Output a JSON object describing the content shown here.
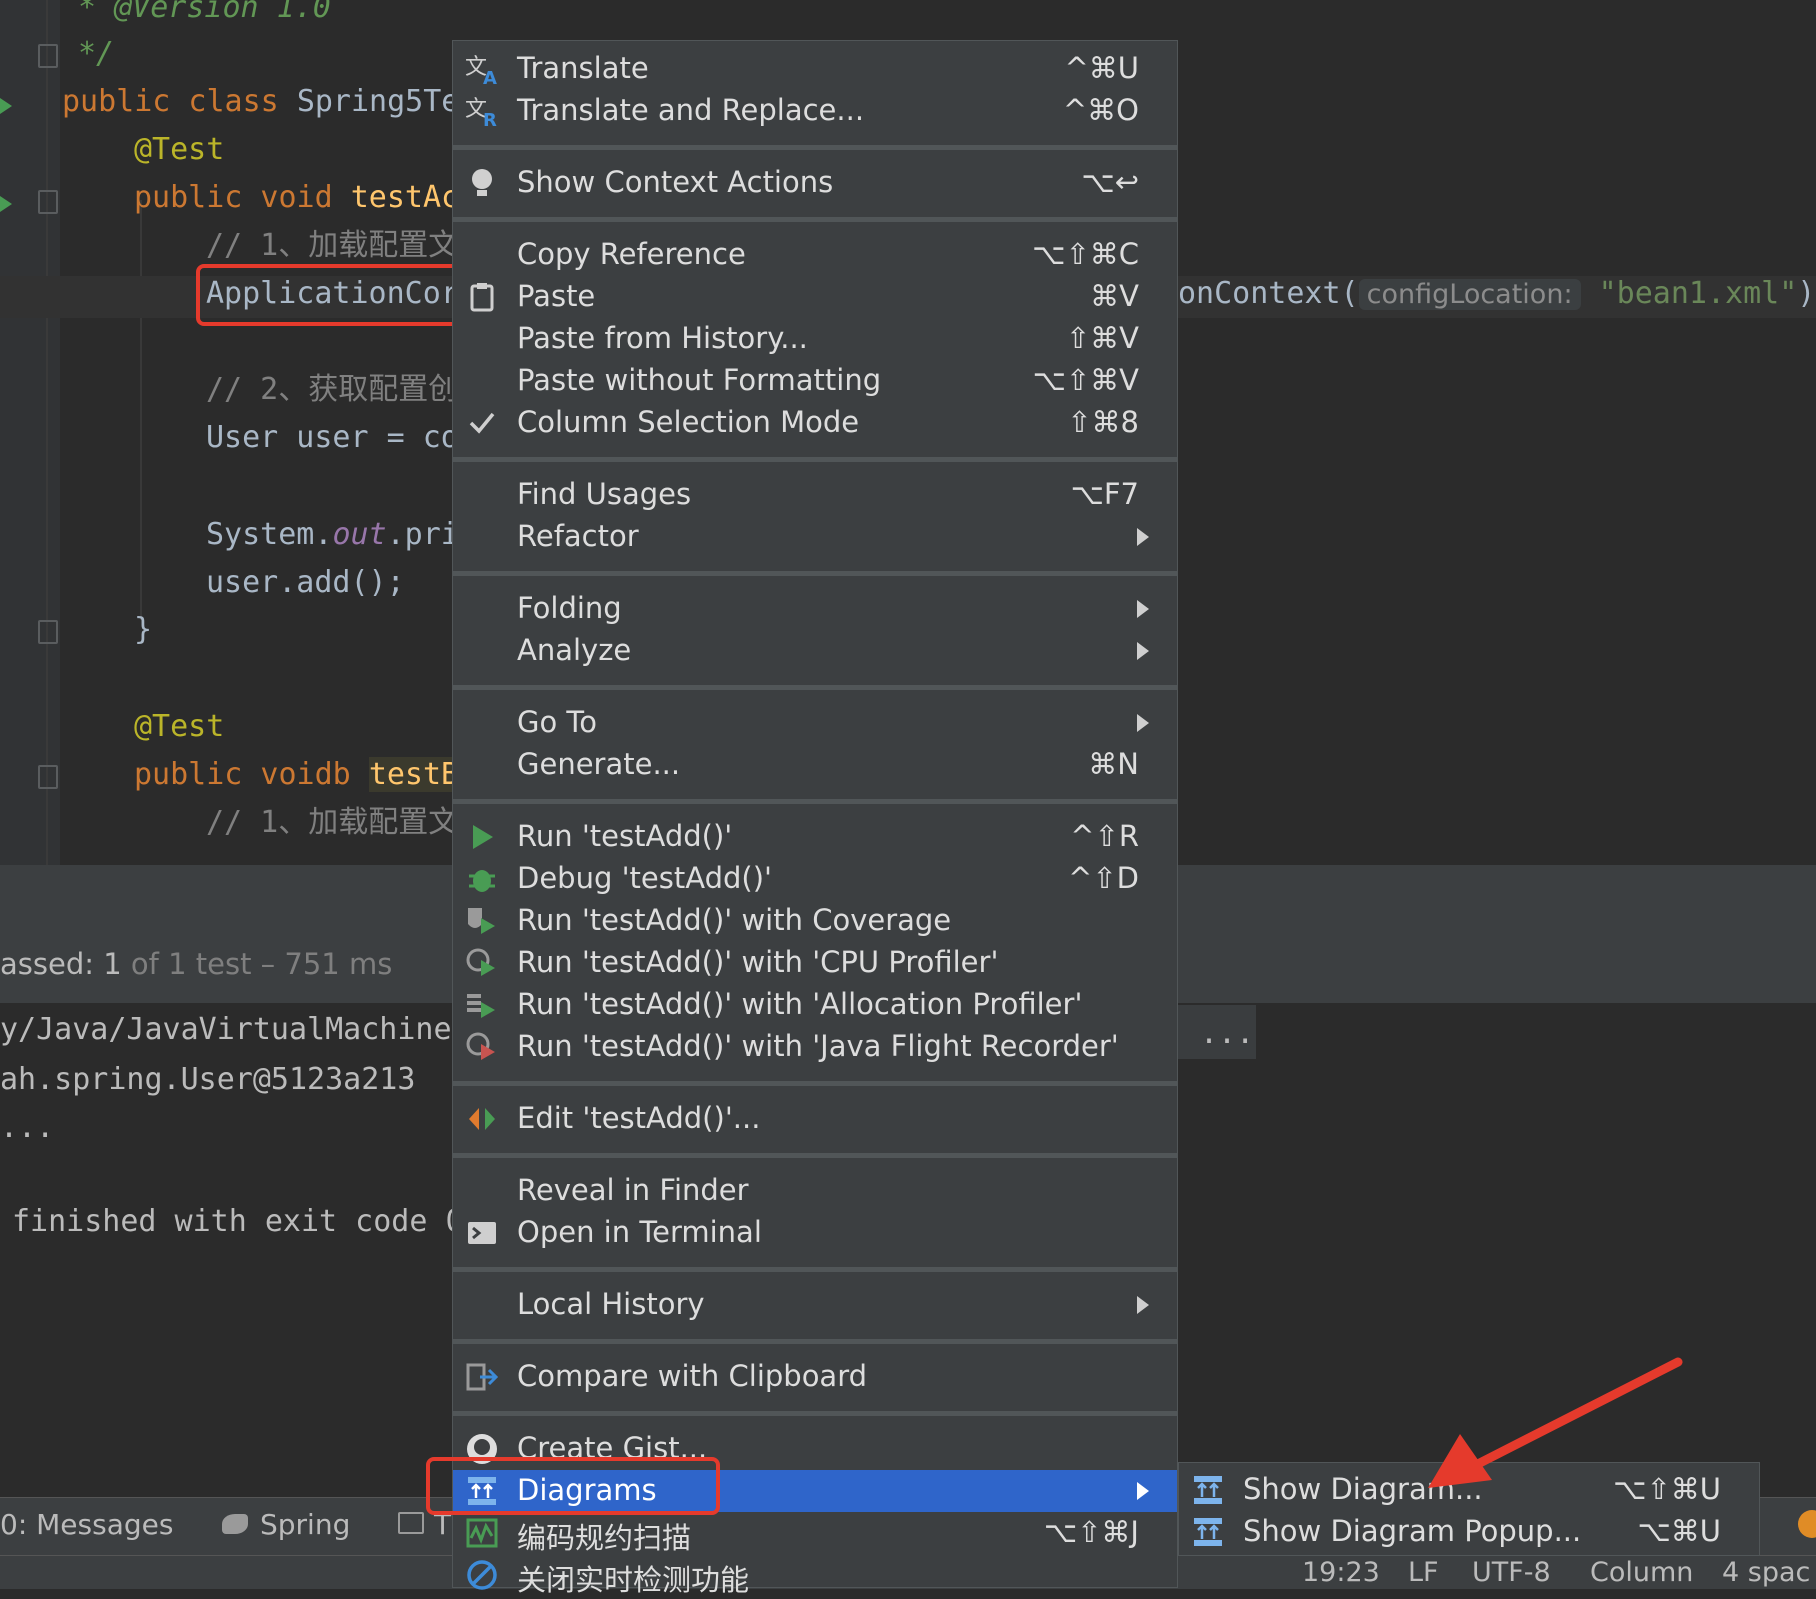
{
  "editor": {
    "doc_version": "* @Version 1.0",
    "doc_close": "*/",
    "class_decl_kw": "public class",
    "class_name": "Spring5Te",
    "ann1": "@Test",
    "method1_kw": "public void",
    "method1_name": "testAc",
    "comment1": "// 1、加载配置文",
    "line_app_ctx": "ApplicationCor",
    "right_ctx": "onContext(",
    "param_hint": "configLocation:",
    "string_val": "\"bean1.xml\"",
    "right_paren": ");",
    "comment2": "// 2、获取配置创",
    "user_line": "User user = co",
    "sys_prefix": "System.",
    "sys_out": "out",
    "sys_suffix": ".pri",
    "user_add": "user.add();",
    "close_brace": "}",
    "ann2": "@Test",
    "method2_kw": "public voidb",
    "method2_name": "testB",
    "comment3": "// 1、加载配置文"
  },
  "console": {
    "passed_prefix": "assed:",
    "passed_count": "1",
    "passed_rest": "of 1 test – 751 ms",
    "path": "y/Java/JavaVirtualMachines",
    "path_more": "...",
    "user_out": "ah.spring.User@5123a213",
    "ellipsis": "...",
    "finished": "finished with exit code 0"
  },
  "bottom_tabs": [
    {
      "label": "0: Messages"
    },
    {
      "label": "Spring"
    },
    {
      "label": "T"
    }
  ],
  "status": {
    "position": "19:23",
    "line_sep": "LF",
    "encoding": "UTF-8",
    "mode": "Column",
    "indent": "4 spac"
  },
  "menu": {
    "translate": {
      "label": "Translate",
      "shortcut": "^⌘U"
    },
    "translate_replace": {
      "label": "Translate and Replace...",
      "shortcut": "^⌘O"
    },
    "context_actions": {
      "label": "Show Context Actions",
      "shortcut": "⌥↩"
    },
    "copy_ref": {
      "label": "Copy Reference",
      "shortcut": "⌥⇧⌘C"
    },
    "paste": {
      "label": "Paste",
      "shortcut": "⌘V"
    },
    "paste_history": {
      "label": "Paste from History...",
      "shortcut": "⇧⌘V"
    },
    "paste_noformat": {
      "label": "Paste without Formatting",
      "shortcut": "⌥⇧⌘V"
    },
    "column_mode": {
      "label": "Column Selection Mode",
      "shortcut": "⇧⌘8"
    },
    "find_usages": {
      "label": "Find Usages",
      "shortcut": "⌥F7"
    },
    "refactor": {
      "label": "Refactor"
    },
    "folding": {
      "label": "Folding"
    },
    "analyze": {
      "label": "Analyze"
    },
    "goto": {
      "label": "Go To"
    },
    "generate": {
      "label": "Generate...",
      "shortcut": "⌘N"
    },
    "run": {
      "label": "Run 'testAdd()'",
      "shortcut": "^⇧R"
    },
    "debug": {
      "label": "Debug 'testAdd()'",
      "shortcut": "^⇧D"
    },
    "run_coverage": {
      "label": "Run 'testAdd()' with Coverage"
    },
    "run_cpu": {
      "label": "Run 'testAdd()' with 'CPU Profiler'"
    },
    "run_alloc": {
      "label": "Run 'testAdd()' with 'Allocation Profiler'"
    },
    "run_jfr": {
      "label": "Run 'testAdd()' with 'Java Flight Recorder'"
    },
    "edit_config": {
      "label": "Edit 'testAdd()'..."
    },
    "reveal_finder": {
      "label": "Reveal in Finder"
    },
    "open_terminal": {
      "label": "Open in Terminal"
    },
    "local_history": {
      "label": "Local History"
    },
    "compare_clipboard": {
      "label": "Compare with Clipboard"
    },
    "create_gist": {
      "label": "Create Gist..."
    },
    "diagrams": {
      "label": "Diagrams"
    },
    "code_scan": {
      "label": "编码规约扫描",
      "shortcut": "⌥⇧⌘J"
    },
    "close_realtime": {
      "label": "关闭实时检测功能"
    }
  },
  "submenu": {
    "show_diagram": {
      "label": "Show Diagram...",
      "shortcut": "⌥⇧⌘U"
    },
    "show_diagram_popup": {
      "label": "Show Diagram Popup...",
      "shortcut": "⌥⌘U"
    }
  },
  "colors": {
    "selection": "#2f65ca",
    "annotation_red": "#e53a2c",
    "menu_bg": "#3c3f41",
    "editor_bg": "#2b2b2b"
  }
}
